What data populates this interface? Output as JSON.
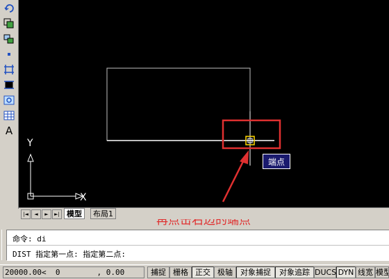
{
  "toolbar": {
    "items": [
      {
        "icon": "rotate-icon"
      },
      {
        "icon": "scale-icon"
      },
      {
        "icon": "copy-icon"
      },
      {
        "icon": "point-icon"
      },
      {
        "icon": "trim-icon"
      },
      {
        "icon": "extend-icon"
      },
      {
        "icon": "zoom-icon"
      },
      {
        "icon": "table-icon"
      },
      {
        "icon": "text-icon",
        "glyph": "A"
      }
    ]
  },
  "canvas": {
    "background": "#000000",
    "ucs": {
      "x_label": "X",
      "y_label": "Y"
    },
    "snap_tooltip": "端点",
    "annotation": "再点击右边的端点",
    "annotation_color": "#e03030"
  },
  "tabs": {
    "nav": [
      "|◄",
      "◄",
      "►",
      "►|"
    ],
    "items": [
      {
        "label": "模型",
        "active": true
      },
      {
        "label": "布局1",
        "active": false
      }
    ]
  },
  "command": {
    "line1": "命令: di",
    "line2": "DIST 指定第一点:  指定第二点:"
  },
  "statusbar": {
    "coords": "20000.00<  0        , 0.00",
    "buttons": [
      {
        "label": "捕捉",
        "on": false
      },
      {
        "label": "栅格",
        "on": false
      },
      {
        "label": "正交",
        "on": true
      },
      {
        "label": "极轴",
        "on": false
      },
      {
        "label": "对象捕捉",
        "on": true
      },
      {
        "label": "对象追踪",
        "on": true
      },
      {
        "label": "DUCS",
        "on": false
      },
      {
        "label": "DYN",
        "on": true
      },
      {
        "label": "线宽",
        "on": false
      },
      {
        "label": "模型",
        "on": false
      }
    ]
  }
}
